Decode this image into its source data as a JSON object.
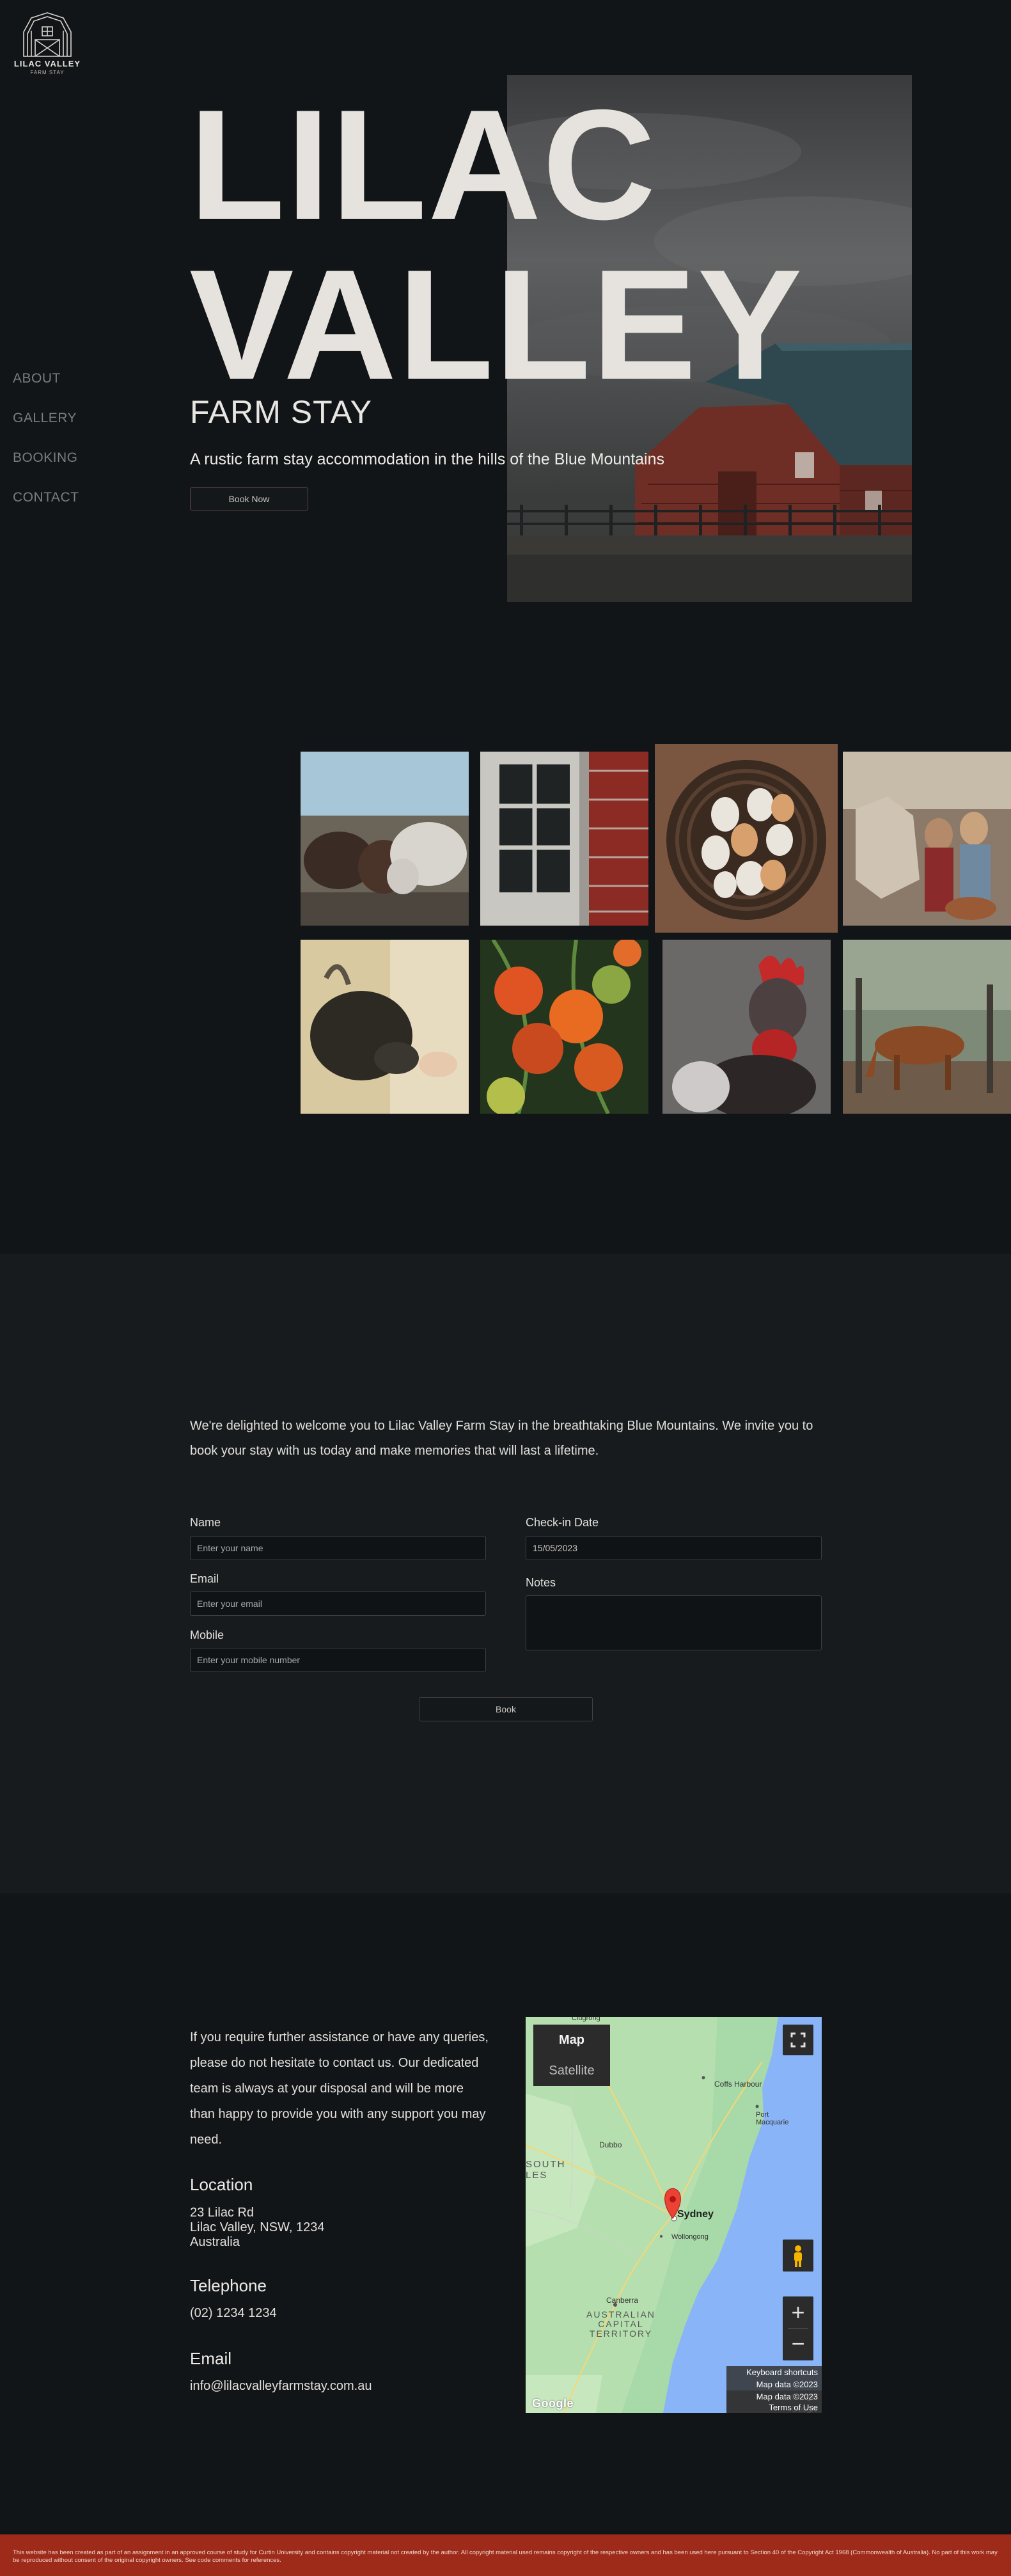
{
  "brand": {
    "logo_title": "LILAC VALLEY",
    "logo_subtitle": "FARM STAY"
  },
  "nav": {
    "items": [
      {
        "label": "ABOUT"
      },
      {
        "label": "GALLERY"
      },
      {
        "label": "BOOKING"
      },
      {
        "label": "CONTACT"
      }
    ]
  },
  "hero": {
    "title_line1": "LILAC",
    "title_line2": "VALLEY",
    "subtitle": "FARM STAY",
    "tagline": "A rustic farm stay accommodation in the hills of the Blue Mountains",
    "cta_label": "Book Now"
  },
  "booking": {
    "welcome": "We're delighted to welcome you to Lilac Valley Farm Stay in the breathtaking Blue Mountains. We invite you to book your stay with us today and make memories that will last a lifetime.",
    "name_label": "Name",
    "name_placeholder": "Enter your name",
    "email_label": "Email",
    "email_placeholder": "Enter your email",
    "mobile_label": "Mobile",
    "mobile_placeholder": "Enter your mobile number",
    "checkin_label": "Check-in Date",
    "checkin_value": "15/05/2023",
    "notes_label": "Notes",
    "submit_label": "Book"
  },
  "contact": {
    "intro": "If you require further assistance or have any queries, please do not hesitate to contact us. Our dedicated team is always at your disposal and will be more than happy to provide you with any support you may need.",
    "location_heading": "Location",
    "address_line1": "23 Lilac Rd",
    "address_line2": "Lilac Valley, NSW, 1234",
    "address_line3": "Australia",
    "telephone_heading": "Telephone",
    "telephone": "(02) 1234 1234",
    "email_heading": "Email",
    "email": "info@lilacvalleyfarmstay.com.au"
  },
  "map": {
    "tab_map": "Map",
    "tab_satellite": "Satellite",
    "labels": {
      "coffs": "Coffs Harbour",
      "port": "Port\nMacquarie",
      "dubbo": "Dubbo",
      "sydney": "Sydney",
      "wollongong": "Wollongong",
      "canberra": "Canberra",
      "act": "AUSTRALIAN\nCAPITAL\nTERRITORY",
      "nsw": "SOUTH\nLES",
      "top": "Clugrong"
    },
    "zoom_in": "+",
    "zoom_out": "−",
    "footer_line1": "Keyboard shortcuts",
    "footer_line2": "Map data ©2023 Google",
    "footer_line3": "Map data ©2023 Google",
    "footer_line4": "Terms of Use",
    "google_logo": "Google"
  },
  "footer": {
    "text": "This website has been created as part of an assignment in an approved course of study for Curtin University and contains copyright material not created by the author. All copyright material used remains copyright of the respective owners and has been used here pursuant to Section 40 of the Copyright Act 1968 (Commonwealth of Australia). No part of this work may be reproduced without consent of the original copyright owners. See code comments for references."
  },
  "colors": {
    "background": "#121517",
    "section_background": "#171b1e",
    "footer_background": "#9e2b1a",
    "accent": "#9e2b1a"
  },
  "gallery": {
    "images": [
      {
        "name": "cows-photo"
      },
      {
        "name": "barn-window-photo"
      },
      {
        "name": "eggs-basket-photo"
      },
      {
        "name": "horse-family-photo"
      },
      {
        "name": "goat-photo"
      },
      {
        "name": "tomatoes-photo"
      },
      {
        "name": "rooster-photo"
      },
      {
        "name": "horses-grazing-photo"
      }
    ]
  }
}
